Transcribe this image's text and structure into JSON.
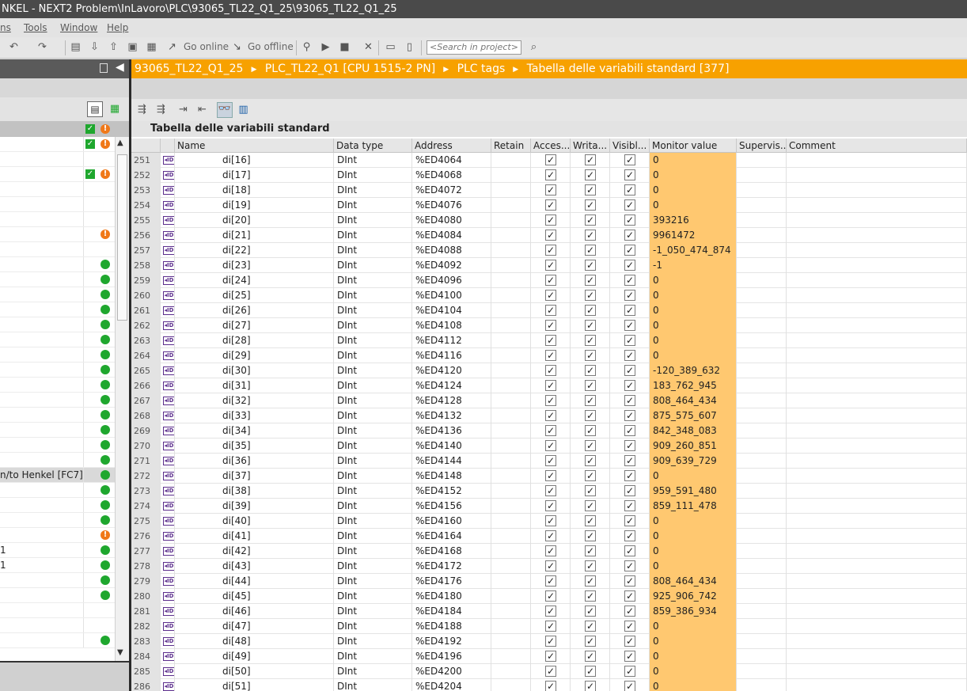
{
  "window": {
    "title": "NKEL - NEXT2 Problem\\InLavoro\\PLC\\93065_TL22_Q1_25\\93065_TL22_Q1_25"
  },
  "menu": {
    "items": [
      "ns",
      "Tools",
      "Window",
      "Help"
    ]
  },
  "toolbar": {
    "go_online": "Go online",
    "go_offline": "Go offline",
    "search_placeholder": "<Search in project>"
  },
  "breadcrumb": [
    "93065_TL22_Q1_25",
    "PLC_TL22_Q1 [CPU 1515-2 PN]",
    "PLC tags",
    "Tabella delle variabili standard [377]"
  ],
  "table": {
    "title": "Tabella delle variabili standard",
    "columns": [
      "Name",
      "Data type",
      "Address",
      "Retain",
      "Acces...",
      "Writa...",
      "Visibl...",
      "Monitor value",
      "Supervis...",
      "Comment"
    ],
    "rows": [
      {
        "n": "251",
        "name": "di[16]",
        "type": "DInt",
        "addr": "%ED4064",
        "mon": "0"
      },
      {
        "n": "252",
        "name": "di[17]",
        "type": "DInt",
        "addr": "%ED4068",
        "mon": "0"
      },
      {
        "n": "253",
        "name": "di[18]",
        "type": "DInt",
        "addr": "%ED4072",
        "mon": "0"
      },
      {
        "n": "254",
        "name": "di[19]",
        "type": "DInt",
        "addr": "%ED4076",
        "mon": "0"
      },
      {
        "n": "255",
        "name": "di[20]",
        "type": "DInt",
        "addr": "%ED4080",
        "mon": "393216"
      },
      {
        "n": "256",
        "name": "di[21]",
        "type": "DInt",
        "addr": "%ED4084",
        "mon": "9961472"
      },
      {
        "n": "257",
        "name": "di[22]",
        "type": "DInt",
        "addr": "%ED4088",
        "mon": "-1_050_474_874"
      },
      {
        "n": "258",
        "name": "di[23]",
        "type": "DInt",
        "addr": "%ED4092",
        "mon": "-1"
      },
      {
        "n": "259",
        "name": "di[24]",
        "type": "DInt",
        "addr": "%ED4096",
        "mon": "0"
      },
      {
        "n": "260",
        "name": "di[25]",
        "type": "DInt",
        "addr": "%ED4100",
        "mon": "0"
      },
      {
        "n": "261",
        "name": "di[26]",
        "type": "DInt",
        "addr": "%ED4104",
        "mon": "0"
      },
      {
        "n": "262",
        "name": "di[27]",
        "type": "DInt",
        "addr": "%ED4108",
        "mon": "0"
      },
      {
        "n": "263",
        "name": "di[28]",
        "type": "DInt",
        "addr": "%ED4112",
        "mon": "0"
      },
      {
        "n": "264",
        "name": "di[29]",
        "type": "DInt",
        "addr": "%ED4116",
        "mon": "0"
      },
      {
        "n": "265",
        "name": "di[30]",
        "type": "DInt",
        "addr": "%ED4120",
        "mon": "-120_389_632"
      },
      {
        "n": "266",
        "name": "di[31]",
        "type": "DInt",
        "addr": "%ED4124",
        "mon": "183_762_945"
      },
      {
        "n": "267",
        "name": "di[32]",
        "type": "DInt",
        "addr": "%ED4128",
        "mon": "808_464_434"
      },
      {
        "n": "268",
        "name": "di[33]",
        "type": "DInt",
        "addr": "%ED4132",
        "mon": "875_575_607"
      },
      {
        "n": "269",
        "name": "di[34]",
        "type": "DInt",
        "addr": "%ED4136",
        "mon": "842_348_083"
      },
      {
        "n": "270",
        "name": "di[35]",
        "type": "DInt",
        "addr": "%ED4140",
        "mon": "909_260_851"
      },
      {
        "n": "271",
        "name": "di[36]",
        "type": "DInt",
        "addr": "%ED4144",
        "mon": "909_639_729"
      },
      {
        "n": "272",
        "name": "di[37]",
        "type": "DInt",
        "addr": "%ED4148",
        "mon": "0"
      },
      {
        "n": "273",
        "name": "di[38]",
        "type": "DInt",
        "addr": "%ED4152",
        "mon": "959_591_480"
      },
      {
        "n": "274",
        "name": "di[39]",
        "type": "DInt",
        "addr": "%ED4156",
        "mon": "859_111_478"
      },
      {
        "n": "275",
        "name": "di[40]",
        "type": "DInt",
        "addr": "%ED4160",
        "mon": "0"
      },
      {
        "n": "276",
        "name": "di[41]",
        "type": "DInt",
        "addr": "%ED4164",
        "mon": "0"
      },
      {
        "n": "277",
        "name": "di[42]",
        "type": "DInt",
        "addr": "%ED4168",
        "mon": "0"
      },
      {
        "n": "278",
        "name": "di[43]",
        "type": "DInt",
        "addr": "%ED4172",
        "mon": "0"
      },
      {
        "n": "279",
        "name": "di[44]",
        "type": "DInt",
        "addr": "%ED4176",
        "mon": "808_464_434"
      },
      {
        "n": "280",
        "name": "di[45]",
        "type": "DInt",
        "addr": "%ED4180",
        "mon": "925_906_742"
      },
      {
        "n": "281",
        "name": "di[46]",
        "type": "DInt",
        "addr": "%ED4184",
        "mon": "859_386_934"
      },
      {
        "n": "282",
        "name": "di[47]",
        "type": "DInt",
        "addr": "%ED4188",
        "mon": "0"
      },
      {
        "n": "283",
        "name": "di[48]",
        "type": "DInt",
        "addr": "%ED4192",
        "mon": "0"
      },
      {
        "n": "284",
        "name": "di[49]",
        "type": "DInt",
        "addr": "%ED4196",
        "mon": "0"
      },
      {
        "n": "285",
        "name": "di[50]",
        "type": "DInt",
        "addr": "%ED4200",
        "mon": "0"
      },
      {
        "n": "286",
        "name": "di[51]",
        "type": "DInt",
        "addr": "%ED4204",
        "mon": "0"
      }
    ]
  },
  "left_tree": {
    "rows": [
      {
        "text": "",
        "status": "check-warn"
      },
      {
        "text": "",
        "status": ""
      },
      {
        "text": "",
        "status": "check-warn"
      },
      {
        "text": "",
        "status": ""
      },
      {
        "text": "",
        "status": ""
      },
      {
        "text": "",
        "status": ""
      },
      {
        "text": "",
        "status": "warn"
      },
      {
        "text": "",
        "status": ""
      },
      {
        "text": "",
        "status": "ok"
      },
      {
        "text": "",
        "status": "ok"
      },
      {
        "text": "",
        "status": "ok"
      },
      {
        "text": "",
        "status": "ok"
      },
      {
        "text": "",
        "status": "ok"
      },
      {
        "text": "",
        "status": "ok"
      },
      {
        "text": "",
        "status": "ok"
      },
      {
        "text": "",
        "status": "ok"
      },
      {
        "text": "",
        "status": "ok"
      },
      {
        "text": "",
        "status": "ok"
      },
      {
        "text": "",
        "status": "ok"
      },
      {
        "text": "",
        "status": "ok"
      },
      {
        "text": "",
        "status": "ok"
      },
      {
        "text": "",
        "status": "ok"
      },
      {
        "text": "n/to Henkel [FC7]",
        "status": "ok"
      },
      {
        "text": "",
        "status": "ok"
      },
      {
        "text": "",
        "status": "ok"
      },
      {
        "text": "",
        "status": "ok"
      },
      {
        "text": "",
        "status": "warn"
      },
      {
        "text": "1",
        "status": "ok"
      },
      {
        "text": "1",
        "status": "ok"
      },
      {
        "text": "",
        "status": "ok"
      },
      {
        "text": "",
        "status": "ok"
      },
      {
        "text": "",
        "status": ""
      },
      {
        "text": "",
        "status": ""
      },
      {
        "text": "",
        "status": "ok"
      }
    ]
  },
  "colors": {
    "accent": "#f7a100",
    "monitor": "#ffc870",
    "ok": "#1fa72e",
    "warn": "#f07818"
  }
}
